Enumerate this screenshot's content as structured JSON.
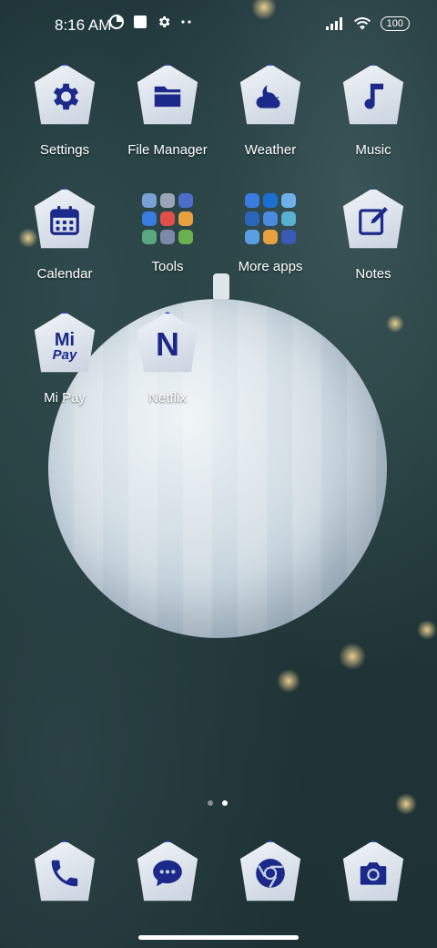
{
  "status": {
    "time": "8:16 AM",
    "battery": "100"
  },
  "apps": [
    {
      "label": "Settings",
      "icon": "gear-icon"
    },
    {
      "label": "File Manager",
      "icon": "folder-icon"
    },
    {
      "label": "Weather",
      "icon": "cloud-moon-icon"
    },
    {
      "label": "Music",
      "icon": "music-note-icon"
    },
    {
      "label": "Calendar",
      "icon": "calendar-icon"
    },
    {
      "label": "Tools",
      "icon": "folder-grid-icon"
    },
    {
      "label": "More apps",
      "icon": "folder-grid-icon"
    },
    {
      "label": "Notes",
      "icon": "edit-icon"
    },
    {
      "label": "Mi Pay",
      "icon": "mi-pay-icon",
      "logo_line1": "Mi",
      "logo_line2": "Pay"
    },
    {
      "label": "Netflix",
      "icon": "netflix-icon",
      "logo": "N"
    }
  ],
  "dock": [
    {
      "name": "Phone",
      "icon": "phone-icon"
    },
    {
      "name": "Messages",
      "icon": "message-icon"
    },
    {
      "name": "Chrome",
      "icon": "chrome-icon"
    },
    {
      "name": "Camera",
      "icon": "camera-icon"
    }
  ],
  "page_indicator": {
    "count": 2,
    "active": 2
  },
  "colors": {
    "icon_border": "#2a4fd6",
    "icon_glyph": "#1b2a8a"
  }
}
